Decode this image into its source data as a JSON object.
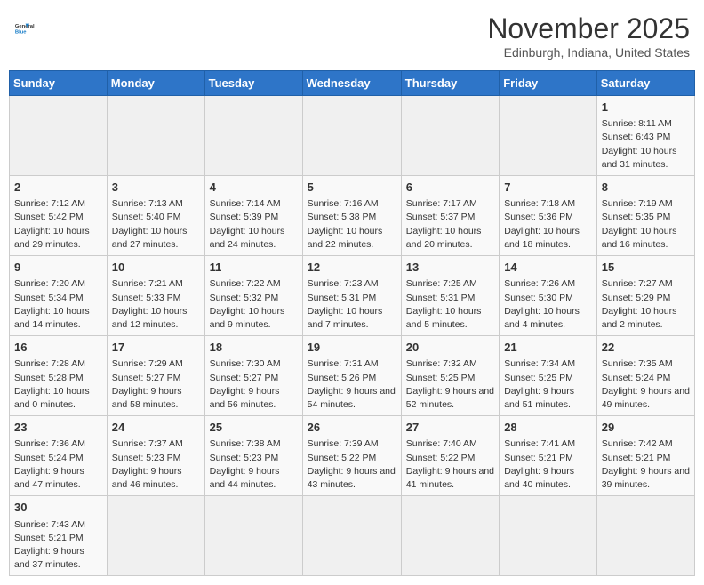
{
  "header": {
    "logo_general": "General",
    "logo_blue": "Blue",
    "month_title": "November 2025",
    "location": "Edinburgh, Indiana, United States"
  },
  "weekdays": [
    "Sunday",
    "Monday",
    "Tuesday",
    "Wednesday",
    "Thursday",
    "Friday",
    "Saturday"
  ],
  "weeks": [
    [
      {
        "day": "",
        "info": ""
      },
      {
        "day": "",
        "info": ""
      },
      {
        "day": "",
        "info": ""
      },
      {
        "day": "",
        "info": ""
      },
      {
        "day": "",
        "info": ""
      },
      {
        "day": "",
        "info": ""
      },
      {
        "day": "1",
        "info": "Sunrise: 8:11 AM\nSunset: 6:43 PM\nDaylight: 10 hours\nand 31 minutes."
      }
    ],
    [
      {
        "day": "2",
        "info": "Sunrise: 7:12 AM\nSunset: 5:42 PM\nDaylight: 10 hours\nand 29 minutes."
      },
      {
        "day": "3",
        "info": "Sunrise: 7:13 AM\nSunset: 5:40 PM\nDaylight: 10 hours\nand 27 minutes."
      },
      {
        "day": "4",
        "info": "Sunrise: 7:14 AM\nSunset: 5:39 PM\nDaylight: 10 hours\nand 24 minutes."
      },
      {
        "day": "5",
        "info": "Sunrise: 7:16 AM\nSunset: 5:38 PM\nDaylight: 10 hours\nand 22 minutes."
      },
      {
        "day": "6",
        "info": "Sunrise: 7:17 AM\nSunset: 5:37 PM\nDaylight: 10 hours\nand 20 minutes."
      },
      {
        "day": "7",
        "info": "Sunrise: 7:18 AM\nSunset: 5:36 PM\nDaylight: 10 hours\nand 18 minutes."
      },
      {
        "day": "8",
        "info": "Sunrise: 7:19 AM\nSunset: 5:35 PM\nDaylight: 10 hours\nand 16 minutes."
      }
    ],
    [
      {
        "day": "9",
        "info": "Sunrise: 7:20 AM\nSunset: 5:34 PM\nDaylight: 10 hours\nand 14 minutes."
      },
      {
        "day": "10",
        "info": "Sunrise: 7:21 AM\nSunset: 5:33 PM\nDaylight: 10 hours\nand 12 minutes."
      },
      {
        "day": "11",
        "info": "Sunrise: 7:22 AM\nSunset: 5:32 PM\nDaylight: 10 hours\nand 9 minutes."
      },
      {
        "day": "12",
        "info": "Sunrise: 7:23 AM\nSunset: 5:31 PM\nDaylight: 10 hours\nand 7 minutes."
      },
      {
        "day": "13",
        "info": "Sunrise: 7:25 AM\nSunset: 5:31 PM\nDaylight: 10 hours\nand 5 minutes."
      },
      {
        "day": "14",
        "info": "Sunrise: 7:26 AM\nSunset: 5:30 PM\nDaylight: 10 hours\nand 4 minutes."
      },
      {
        "day": "15",
        "info": "Sunrise: 7:27 AM\nSunset: 5:29 PM\nDaylight: 10 hours\nand 2 minutes."
      }
    ],
    [
      {
        "day": "16",
        "info": "Sunrise: 7:28 AM\nSunset: 5:28 PM\nDaylight: 10 hours\nand 0 minutes."
      },
      {
        "day": "17",
        "info": "Sunrise: 7:29 AM\nSunset: 5:27 PM\nDaylight: 9 hours\nand 58 minutes."
      },
      {
        "day": "18",
        "info": "Sunrise: 7:30 AM\nSunset: 5:27 PM\nDaylight: 9 hours\nand 56 minutes."
      },
      {
        "day": "19",
        "info": "Sunrise: 7:31 AM\nSunset: 5:26 PM\nDaylight: 9 hours\nand 54 minutes."
      },
      {
        "day": "20",
        "info": "Sunrise: 7:32 AM\nSunset: 5:25 PM\nDaylight: 9 hours\nand 52 minutes."
      },
      {
        "day": "21",
        "info": "Sunrise: 7:34 AM\nSunset: 5:25 PM\nDaylight: 9 hours\nand 51 minutes."
      },
      {
        "day": "22",
        "info": "Sunrise: 7:35 AM\nSunset: 5:24 PM\nDaylight: 9 hours\nand 49 minutes."
      }
    ],
    [
      {
        "day": "23",
        "info": "Sunrise: 7:36 AM\nSunset: 5:24 PM\nDaylight: 9 hours\nand 47 minutes."
      },
      {
        "day": "24",
        "info": "Sunrise: 7:37 AM\nSunset: 5:23 PM\nDaylight: 9 hours\nand 46 minutes."
      },
      {
        "day": "25",
        "info": "Sunrise: 7:38 AM\nSunset: 5:23 PM\nDaylight: 9 hours\nand 44 minutes."
      },
      {
        "day": "26",
        "info": "Sunrise: 7:39 AM\nSunset: 5:22 PM\nDaylight: 9 hours\nand 43 minutes."
      },
      {
        "day": "27",
        "info": "Sunrise: 7:40 AM\nSunset: 5:22 PM\nDaylight: 9 hours\nand 41 minutes."
      },
      {
        "day": "28",
        "info": "Sunrise: 7:41 AM\nSunset: 5:21 PM\nDaylight: 9 hours\nand 40 minutes."
      },
      {
        "day": "29",
        "info": "Sunrise: 7:42 AM\nSunset: 5:21 PM\nDaylight: 9 hours\nand 39 minutes."
      }
    ],
    [
      {
        "day": "30",
        "info": "Sunrise: 7:43 AM\nSunset: 5:21 PM\nDaylight: 9 hours\nand 37 minutes."
      },
      {
        "day": "",
        "info": ""
      },
      {
        "day": "",
        "info": ""
      },
      {
        "day": "",
        "info": ""
      },
      {
        "day": "",
        "info": ""
      },
      {
        "day": "",
        "info": ""
      },
      {
        "day": "",
        "info": ""
      }
    ]
  ]
}
